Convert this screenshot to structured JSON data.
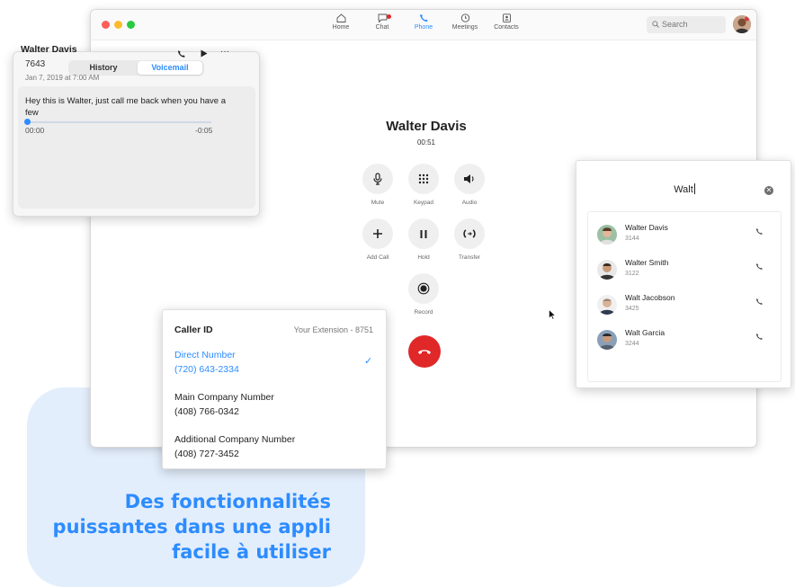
{
  "colors": {
    "accent": "#2d8cff",
    "hangup": "#e02828",
    "promo_bg": "#e3eefc"
  },
  "nav": {
    "items": [
      {
        "label": "Home",
        "icon": "home-icon"
      },
      {
        "label": "Chat",
        "icon": "chat-icon"
      },
      {
        "label": "Phone",
        "icon": "phone-icon",
        "active": true
      },
      {
        "label": "Meetings",
        "icon": "clock-icon"
      },
      {
        "label": "Contacts",
        "icon": "contacts-icon"
      }
    ],
    "search_placeholder": "Search"
  },
  "call": {
    "name": "Walter Davis",
    "duration": "00:51",
    "controls": [
      "Mute",
      "Keypad",
      "Audio",
      "Add Call",
      "Hold",
      "Transfer",
      "Record"
    ]
  },
  "voicemail_panel": {
    "tabs": [
      "History",
      "Voicemail"
    ],
    "active_tab": "Voicemail",
    "entry": {
      "name": "Walter Davis",
      "number": "7643",
      "date": "Jan 7, 2019 at 7:00 AM",
      "transcript": "Hey this is Walter, just call me back when you have a few",
      "elapsed": "00:00",
      "remaining": "-0:05",
      "more": "···"
    }
  },
  "caller_id": {
    "title": "Caller ID",
    "extension": "Your Extension - 8751",
    "options": [
      {
        "label": "Direct Number",
        "number": "(720) 643-2334",
        "selected": true
      },
      {
        "label": "Main Company Number",
        "number": "(408) 766-0342",
        "selected": false
      },
      {
        "label": "Additional Company Number",
        "number": "(408) 727-3452",
        "selected": false
      }
    ]
  },
  "contact_search": {
    "query": "Walt",
    "results": [
      {
        "name": "Walter Davis",
        "ext": "3144"
      },
      {
        "name": "Walter Smith",
        "ext": "3122"
      },
      {
        "name": "Walt Jacobson",
        "ext": "3425"
      },
      {
        "name": "Walt Garcia",
        "ext": "3244"
      }
    ]
  },
  "promo": {
    "text": "Des fonctionnalités\npuissantes dans une appli\nfacile à utiliser"
  }
}
